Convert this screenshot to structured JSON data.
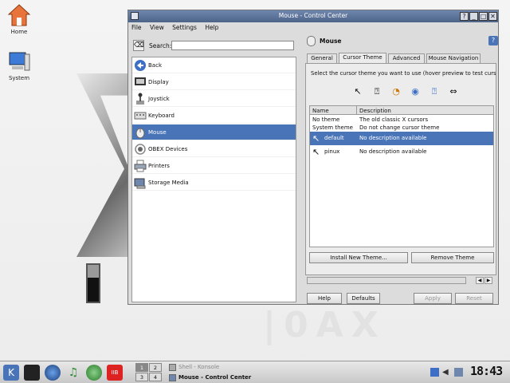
{
  "desktop": {
    "icons": [
      {
        "label": "Home",
        "icon": "home-icon"
      },
      {
        "label": "System",
        "icon": "computer-icon"
      }
    ]
  },
  "window": {
    "title": "Mouse - Control Center",
    "titlebar_buttons": [
      "?",
      "_",
      "□",
      "✕"
    ],
    "menu": [
      "File",
      "View",
      "Settings",
      "Help"
    ],
    "search_label": "Search:",
    "search_value": "",
    "modules": [
      {
        "label": "Back",
        "icon": "back-arrow-icon",
        "color": "#3d6fc6"
      },
      {
        "label": "Display",
        "icon": "display-icon",
        "color": "#555555"
      },
      {
        "label": "Joystick",
        "icon": "joystick-icon",
        "color": "#999999"
      },
      {
        "label": "Keyboard",
        "icon": "keyboard-icon",
        "color": "#aaaaaa"
      },
      {
        "label": "Mouse",
        "icon": "mouse-icon",
        "color": "#cccccc",
        "selected": true
      },
      {
        "label": "OBEX Devices",
        "icon": "obex-icon",
        "color": "#888888"
      },
      {
        "label": "Printers",
        "icon": "printer-icon",
        "color": "#9aa6b8"
      },
      {
        "label": "Storage Media",
        "icon": "storage-icon",
        "color": "#6f86ad"
      }
    ],
    "module_title": "Mouse",
    "tabs": [
      "General",
      "Cursor Theme",
      "Advanced",
      "Mouse Navigation"
    ],
    "active_tab": "Cursor Theme",
    "description": "Select the cursor theme you want to use (hover preview to test cursor",
    "table": {
      "columns": [
        "Name",
        "Description"
      ],
      "rows": [
        {
          "name": "No theme",
          "description": "The old classic X cursors"
        },
        {
          "name": "System theme",
          "description": "Do not change cursor theme"
        },
        {
          "name": "default",
          "description": "No description available",
          "selected": true
        },
        {
          "name": "pinux",
          "description": "No description available"
        }
      ]
    },
    "buttons": {
      "install": "Install New Theme...",
      "remove": "Remove Theme",
      "help": "Help",
      "defaults": "Defaults",
      "apply": "Apply",
      "reset": "Reset"
    }
  },
  "taskbar": {
    "pager": [
      "1",
      "2",
      "3",
      "4"
    ],
    "tasks": [
      {
        "label": "Shell - Konsole",
        "active": false
      },
      {
        "label": "Mouse - Control Center",
        "active": true
      }
    ],
    "clock": "18:43"
  },
  "colors": {
    "accent": "#4a74b8",
    "titlebar": "#5a7199"
  }
}
